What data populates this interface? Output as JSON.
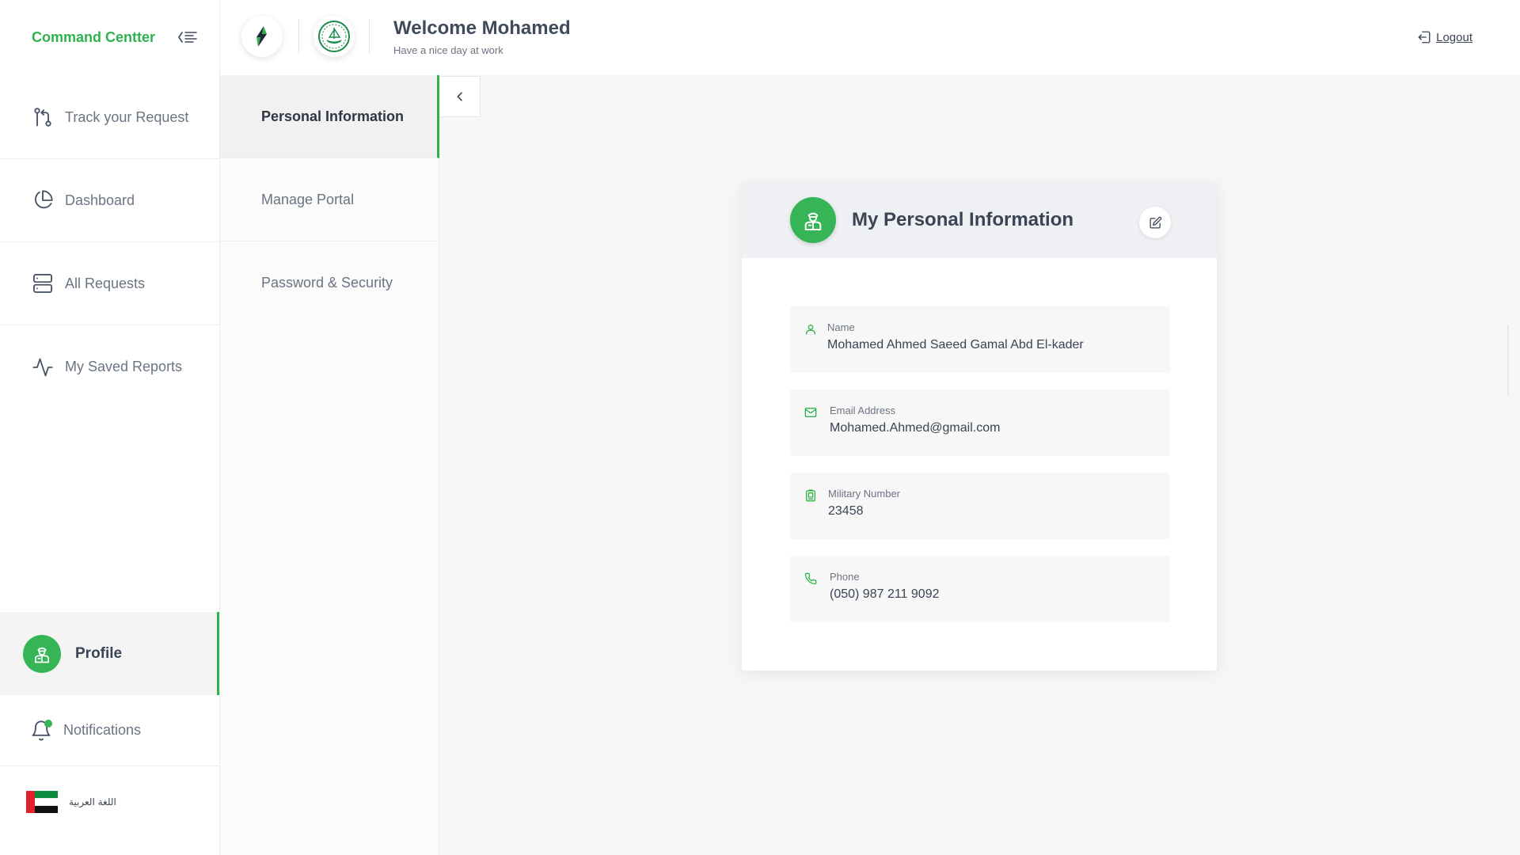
{
  "sidebar": {
    "brand": "Command Centter",
    "items": [
      {
        "label": "Track your Request",
        "icon": "git-pull-request-icon"
      },
      {
        "label": "Dashboard",
        "icon": "pie-chart-icon"
      },
      {
        "label": "All Requests",
        "icon": "server-icon"
      },
      {
        "label": "My Saved Reports",
        "icon": "activity-icon"
      }
    ],
    "profile_label": "Profile",
    "notifications_label": "Notifications",
    "language_label": "اللغة العربية"
  },
  "header": {
    "welcome_title": "Welcome Mohamed",
    "welcome_subtitle": "Have a nice day at work",
    "logout_label": "Logout"
  },
  "submenu": {
    "items": [
      "Personal Information",
      "Manage Portal",
      "Password & Security"
    ],
    "active_index": 0
  },
  "card": {
    "title": "My Personal Information",
    "fields": [
      {
        "label": "Name",
        "value": "Mohamed Ahmed Saeed Gamal Abd El-kader",
        "icon": "user-icon"
      },
      {
        "label": "Email Address",
        "value": "Mohamed.Ahmed@gmail.com",
        "icon": "mail-icon"
      },
      {
        "label": "Military Number",
        "value": "23458",
        "icon": "id-badge-icon"
      },
      {
        "label": "Phone",
        "value": "(050) 987 211 9092",
        "icon": "phone-icon"
      }
    ]
  },
  "colors": {
    "accent": "#2fb24d",
    "text": "#3f4a5a",
    "muted": "#6b7482",
    "background": "#f7f7f7"
  }
}
